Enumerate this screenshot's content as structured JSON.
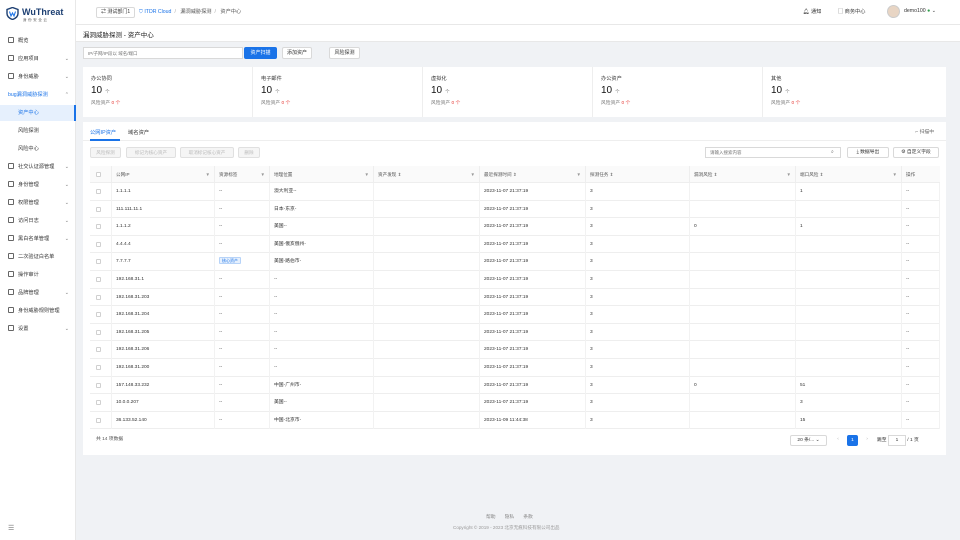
{
  "brand": {
    "name": "WuThreat",
    "tagline": "身份安全云"
  },
  "topbar": {
    "dept": "测试部门1",
    "crumbs": [
      "ITDR Cloud",
      "漏洞威胁探测",
      "资产中心"
    ],
    "notice": "通知",
    "workorder": "商务中心",
    "user": "demo100"
  },
  "sidebar": {
    "items": [
      {
        "label": "概览"
      },
      {
        "label": "应用项目"
      },
      {
        "label": "身份威胁"
      },
      {
        "label": "bug漏洞威胁探测"
      },
      {
        "label": "资产中心"
      },
      {
        "label": "风险探测"
      },
      {
        "label": "风险中心"
      },
      {
        "label": "社交认证源管理"
      },
      {
        "label": "身份管理"
      },
      {
        "label": "权限管理"
      },
      {
        "label": "访问日志"
      },
      {
        "label": "黑白名单管理"
      },
      {
        "label": "二次验证白名单"
      },
      {
        "label": "操作审计"
      },
      {
        "label": "品牌管理"
      },
      {
        "label": "身份威胁规则管理"
      },
      {
        "label": "设置"
      }
    ]
  },
  "page": {
    "title": "漏洞威胁探测 - 资产中心"
  },
  "search": {
    "placeholder": "IP/子网/IP段以 域名/端口",
    "asset_scan": "资产扫描",
    "add_asset": "添加资产",
    "risk_detect": "风险探测"
  },
  "stats": [
    {
      "label": "办公协同",
      "value": "10",
      "unit": "个",
      "risk_label": "风险资产",
      "risk": "0 个"
    },
    {
      "label": "电子邮件",
      "value": "10",
      "unit": "个",
      "risk_label": "风险资产",
      "risk": "0 个"
    },
    {
      "label": "虚拟化",
      "value": "10",
      "unit": "个",
      "risk_label": "风险资产",
      "risk": "0 个"
    },
    {
      "label": "办公资产",
      "value": "10",
      "unit": "个",
      "risk_label": "风险资产",
      "risk": "0 个"
    },
    {
      "label": "其他",
      "value": "10",
      "unit": "个",
      "risk_label": "风险资产",
      "risk": "0 个"
    }
  ],
  "tabs": {
    "t1": "公网IP资产",
    "t2": "域名资产",
    "expand": "扫描中"
  },
  "actions": {
    "a1": "风险探测",
    "a2": "标记为核心资产",
    "a3": "取消标记核心资产",
    "a4": "删除",
    "filter_placeholder": "请输入搜索内容",
    "export": "数据导出",
    "columns": "自定义字段"
  },
  "table": {
    "headers": [
      "公网IP",
      "资源标签",
      "地理位置",
      "资产发现",
      "最近探测时间",
      "探测任务",
      "漏洞风险",
      "端口风险",
      "操作"
    ],
    "rows": [
      {
        "ip": "1.1.1.1",
        "tag": "--",
        "loc": "澳大利亚--",
        "time": "2023-11-07 21:37:19",
        "task": "3",
        "vuln": "",
        "port": "1",
        "op": "--"
      },
      {
        "ip": "111.111.11.1",
        "tag": "--",
        "loc": "日本-东京-",
        "time": "2023-11-07 21:37:19",
        "task": "3",
        "vuln": "",
        "port": "",
        "op": "--"
      },
      {
        "ip": "1.1.1.2",
        "tag": "--",
        "loc": "美国--",
        "time": "2023-11-07 21:37:19",
        "task": "3",
        "vuln": "0",
        "port": "1",
        "op": "--"
      },
      {
        "ip": "4.4.4.4",
        "tag": "--",
        "loc": "美国-俄亥俄州-",
        "time": "2023-11-07 21:37:19",
        "task": "3",
        "vuln": "",
        "port": "",
        "op": "--"
      },
      {
        "ip": "7.7.7.7",
        "tag": "核心资产",
        "loc": "美国-路伯市-",
        "time": "2023-11-07 21:37:19",
        "task": "3",
        "vuln": "",
        "port": "",
        "op": "--"
      },
      {
        "ip": "192.168.31.1",
        "tag": "--",
        "loc": "--",
        "time": "2023-11-07 21:37:19",
        "task": "3",
        "vuln": "",
        "port": "",
        "op": "--"
      },
      {
        "ip": "192.168.31.203",
        "tag": "--",
        "loc": "--",
        "time": "2023-11-07 21:37:19",
        "task": "3",
        "vuln": "",
        "port": "",
        "op": "--"
      },
      {
        "ip": "192.168.31.204",
        "tag": "--",
        "loc": "--",
        "time": "2023-11-07 21:37:19",
        "task": "3",
        "vuln": "",
        "port": "",
        "op": "--"
      },
      {
        "ip": "192.168.31.205",
        "tag": "--",
        "loc": "--",
        "time": "2023-11-07 21:37:19",
        "task": "3",
        "vuln": "",
        "port": "",
        "op": "--"
      },
      {
        "ip": "192.168.31.206",
        "tag": "--",
        "loc": "--",
        "time": "2023-11-07 21:37:19",
        "task": "3",
        "vuln": "",
        "port": "",
        "op": "--"
      },
      {
        "ip": "192.168.31.200",
        "tag": "--",
        "loc": "--",
        "time": "2023-11-07 21:37:19",
        "task": "3",
        "vuln": "",
        "port": "",
        "op": "--"
      },
      {
        "ip": "157.148.33.232",
        "tag": "--",
        "loc": "中国-广州市-",
        "time": "2023-11-07 21:37:19",
        "task": "3",
        "vuln": "0",
        "port": "51",
        "op": "--"
      },
      {
        "ip": "10.0.0.207",
        "tag": "--",
        "loc": "美国--",
        "time": "2023-11-07 21:37:19",
        "task": "3",
        "vuln": "",
        "port": "3",
        "op": "--"
      },
      {
        "ip": "36.133.52.140",
        "tag": "--",
        "loc": "中国-北京市-",
        "time": "2023-11-09 11:44:38",
        "task": "3",
        "vuln": "",
        "port": "15",
        "op": "--"
      }
    ]
  },
  "pagination": {
    "total": "共 14 项数据",
    "size": "20 条/...",
    "current": "1",
    "jump_label": "跳至",
    "jump_value": "1",
    "pages": "/ 1 页"
  },
  "footer": {
    "links": [
      "帮助",
      "隐私",
      "条款"
    ],
    "copyright": "Copyright © 2019 - 2023 北京无痕科技有限公司出品"
  }
}
